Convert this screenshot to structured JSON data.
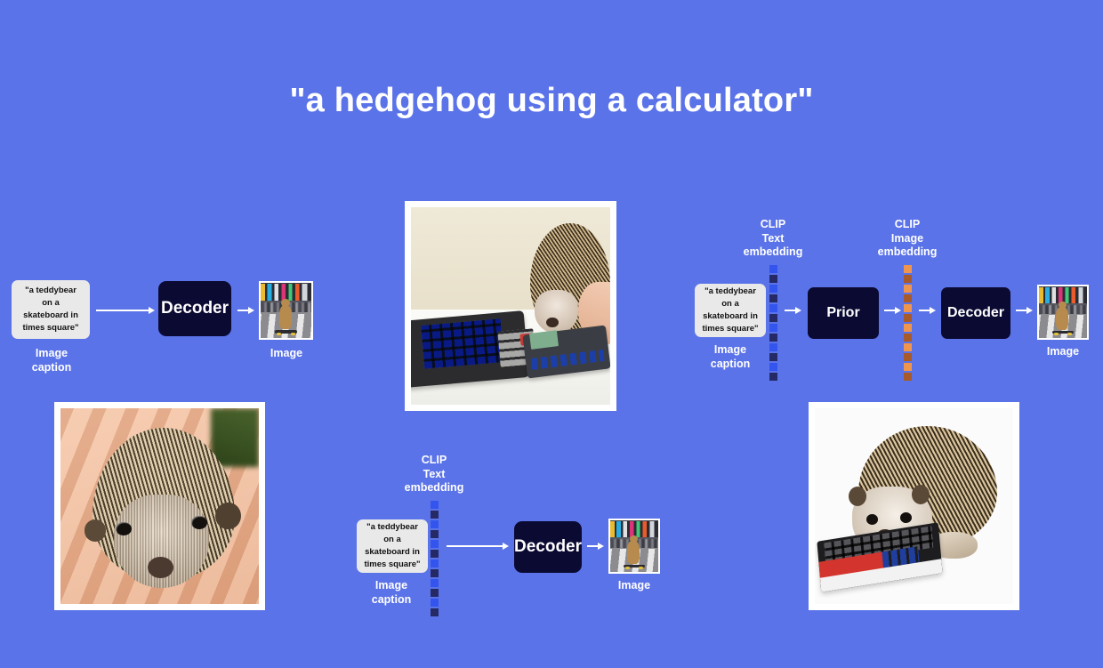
{
  "page": {
    "background_color": "#5b73e8",
    "title": "\"a hedgehog using a calculator\""
  },
  "labels": {
    "caption_text": "\"a teddybear on a skateboard in times square\"",
    "caption_line1": "\"a teddybear",
    "caption_line2": "on a",
    "caption_line3": "skateboard in",
    "caption_line4": "times square\"",
    "image_caption": "Image\ncaption",
    "image": "Image",
    "decoder": "Decoder",
    "prior": "Prior",
    "clip_text_embedding": "CLIP\nText\nembedding",
    "clip_image_embedding": "CLIP\nImage\nembedding"
  },
  "diagrams": [
    {
      "id": "decoder-only",
      "position": "top-left",
      "nodes": [
        {
          "type": "caption",
          "label": "\"a teddybear on a skateboard in times square\"",
          "sublabel": "Image caption"
        },
        {
          "type": "arrow",
          "style": "long"
        },
        {
          "type": "model",
          "label": "Decoder"
        },
        {
          "type": "arrow",
          "style": "short"
        },
        {
          "type": "thumbnail",
          "label": "Image",
          "content": "teddybear-on-skateboard-in-times-square"
        }
      ]
    },
    {
      "id": "clip-text-decoder",
      "position": "bottom-center",
      "nodes": [
        {
          "type": "caption",
          "label": "\"a teddybear on a skateboard in times square\"",
          "sublabel": "Image caption"
        },
        {
          "type": "embedding",
          "label": "CLIP Text embedding",
          "color": "blue"
        },
        {
          "type": "arrow",
          "style": "long"
        },
        {
          "type": "model",
          "label": "Decoder"
        },
        {
          "type": "arrow",
          "style": "short"
        },
        {
          "type": "thumbnail",
          "label": "Image",
          "content": "teddybear-on-skateboard-in-times-square"
        }
      ]
    },
    {
      "id": "prior-decoder",
      "position": "top-right",
      "nodes": [
        {
          "type": "caption",
          "label": "\"a teddybear on a skateboard in times square\"",
          "sublabel": "Image caption"
        },
        {
          "type": "embedding",
          "label": "CLIP Text embedding",
          "color": "blue"
        },
        {
          "type": "arrow",
          "style": "short"
        },
        {
          "type": "model",
          "label": "Prior"
        },
        {
          "type": "arrow",
          "style": "short"
        },
        {
          "type": "embedding",
          "label": "CLIP Image embedding",
          "color": "orange"
        },
        {
          "type": "arrow",
          "style": "short"
        },
        {
          "type": "model",
          "label": "Decoder"
        },
        {
          "type": "arrow",
          "style": "short"
        },
        {
          "type": "thumbnail",
          "label": "Image",
          "content": "teddybear-on-skateboard-in-times-square"
        }
      ]
    }
  ],
  "photos": [
    {
      "id": "hedgehog-calculator-desk",
      "position": "top-center",
      "description": "hedgehog beside desktop calculators on a desk"
    },
    {
      "id": "hedgehog-in-hand",
      "position": "bottom-left",
      "description": "baby hedgehog held in a human hand"
    },
    {
      "id": "hedgehog-on-calculator",
      "position": "bottom-right",
      "description": "hedgehog standing on a red and white calculator"
    }
  ],
  "colors": {
    "background": "#5b73e8",
    "model_box": "#0b0a33",
    "caption_box": "#e9e9e9",
    "text_embedding_light": "#3355ee",
    "text_embedding_dark": "#252a66",
    "image_embedding_light": "#f0954e",
    "image_embedding_dark": "#a85a28",
    "text": "#ffffff"
  },
  "embeddings": {
    "text_cells": [
      "#3355ee",
      "#252a66",
      "#3355ee",
      "#252a66",
      "#3355ee",
      "#252a66",
      "#3355ee",
      "#252a66",
      "#3355ee",
      "#252a66",
      "#3355ee",
      "#252a66"
    ],
    "image_cells": [
      "#f0954e",
      "#a85a28",
      "#f0954e",
      "#a85a28",
      "#f0954e",
      "#a85a28",
      "#f0954e",
      "#a85a28",
      "#f0954e",
      "#a85a28",
      "#f0954e",
      "#a85a28"
    ]
  }
}
